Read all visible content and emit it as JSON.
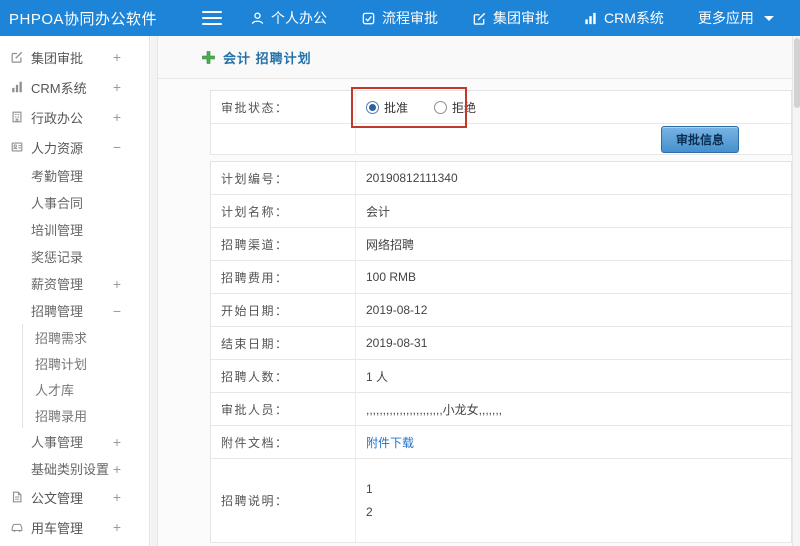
{
  "app": {
    "brand": "PHPOA协同办公软件"
  },
  "topbar": {
    "items": [
      {
        "label": "个人办公",
        "icon": "person-icon"
      },
      {
        "label": "流程审批",
        "icon": "process-icon"
      },
      {
        "label": "集团审批",
        "icon": "edit-icon"
      },
      {
        "label": "CRM系统",
        "icon": "chart-icon"
      },
      {
        "label": "更多应用",
        "icon": "caret-down-icon"
      }
    ]
  },
  "sidebar": {
    "items": [
      {
        "label": "集团审批",
        "icon": "edit-icon",
        "expander": "+"
      },
      {
        "label": "CRM系统",
        "icon": "chart-icon",
        "expander": "+"
      },
      {
        "label": "行政办公",
        "icon": "building-icon",
        "expander": "+"
      },
      {
        "label": "人力资源",
        "icon": "hr-icon",
        "expander": "−"
      },
      {
        "label": "考勤管理"
      },
      {
        "label": "人事合同"
      },
      {
        "label": "培训管理"
      },
      {
        "label": "奖惩记录"
      },
      {
        "label": "薪资管理",
        "expander": "+"
      },
      {
        "label": "招聘管理",
        "expander": "−"
      },
      {
        "label": "招聘需求"
      },
      {
        "label": "招聘计划"
      },
      {
        "label": "人才库"
      },
      {
        "label": "招聘录用"
      },
      {
        "label": "人事管理",
        "expander": "+"
      },
      {
        "label": "基础类别设置",
        "expander": "+"
      },
      {
        "label": "公文管理",
        "icon": "document-icon",
        "expander": "+"
      },
      {
        "label": "用车管理",
        "icon": "car-icon",
        "expander": "+"
      }
    ]
  },
  "page": {
    "title": "会计 招聘计划"
  },
  "form": {
    "status": {
      "label": "审批状态：",
      "options": [
        {
          "label": "批准",
          "checked": true
        },
        {
          "label": "拒绝",
          "checked": false
        }
      ]
    },
    "approve_button": "审批信息",
    "rows": [
      {
        "label": "计划编号：",
        "value": "20190812111340"
      },
      {
        "label": "计划名称：",
        "value": "会计"
      },
      {
        "label": "招聘渠道：",
        "value": "网络招聘"
      },
      {
        "label": "招聘费用：",
        "value": "100 RMB"
      },
      {
        "label": "开始日期：",
        "value": "2019-08-12"
      },
      {
        "label": "结束日期：",
        "value": "2019-08-31"
      },
      {
        "label": "招聘人数：",
        "value": "1 人"
      },
      {
        "label": "审批人员：",
        "value": ",,,,,,,,,,,,,,,,,,,,,,,小龙女,,,,,,,"
      },
      {
        "label": "附件文档：",
        "value": "附件下载"
      },
      {
        "label": "招聘说明：",
        "value_lines": [
          "1",
          "2"
        ]
      }
    ]
  },
  "colors": {
    "topbar_blue": "#1d84d8",
    "title_blue": "#2470a8",
    "link_blue": "#2470c8",
    "annotation_red": "#c0392b",
    "button_blue": "#4690cd",
    "add_icon_green": "#4caf50"
  }
}
